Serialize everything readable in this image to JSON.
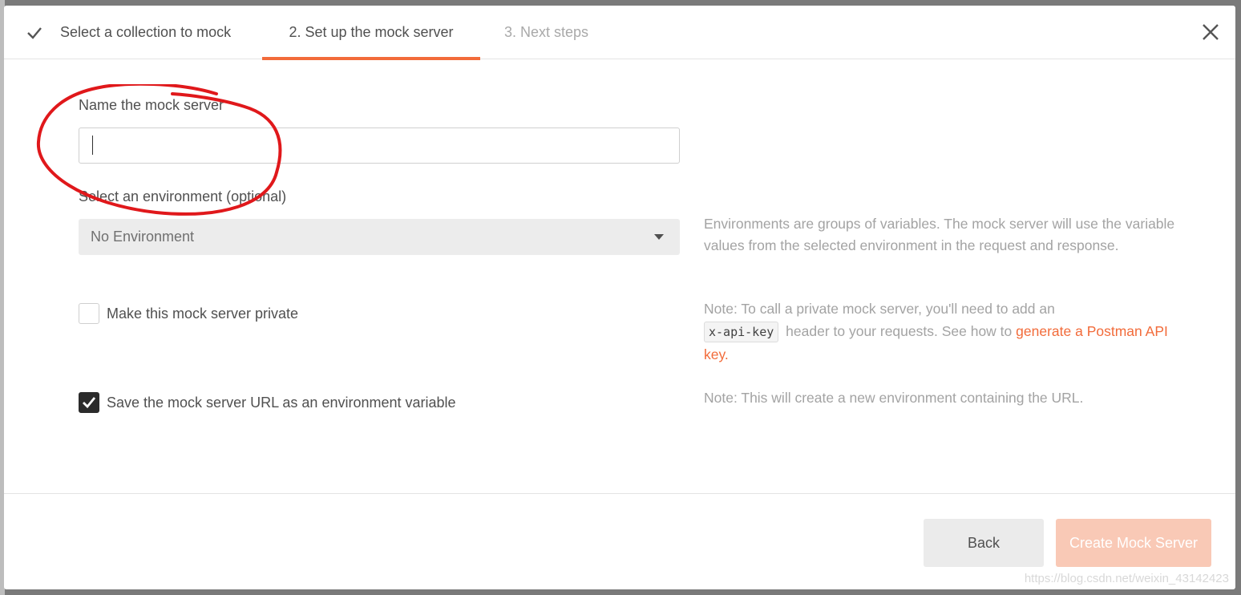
{
  "wizard": {
    "steps": [
      {
        "label": "Select a collection to mock",
        "state": "done"
      },
      {
        "label": "2. Set up the mock server",
        "state": "active"
      },
      {
        "label": "3. Next steps",
        "state": "future"
      }
    ],
    "close_icon": "close-icon",
    "check_icon": "check-icon"
  },
  "form": {
    "name_label": "Name the mock server",
    "name_value": "",
    "env_label": "Select an environment (optional)",
    "env_selected": "No Environment",
    "private_label": "Make this mock server private",
    "private_checked": false,
    "save_label": "Save the mock server URL as an environment variable",
    "save_checked": true
  },
  "help": {
    "env_text": "Environments are groups of variables. The mock server will use the variable values from the selected environment in the request and response.",
    "private_note_prefix": "Note: To call a private mock server, you'll need to add an",
    "private_code": "x-api-key",
    "private_note_middle": "header to your requests. See how to",
    "private_link": "generate a Postman API key.",
    "save_note": "Note: This will create a new environment containing the URL."
  },
  "footer": {
    "back_label": "Back",
    "create_label": "Create Mock Server"
  },
  "watermark": "https://blog.csdn.net/weixin_43142423",
  "colors": {
    "accent": "#f26b3a",
    "create_disabled": "#f9c9b6",
    "annotation": "#e0181b"
  }
}
